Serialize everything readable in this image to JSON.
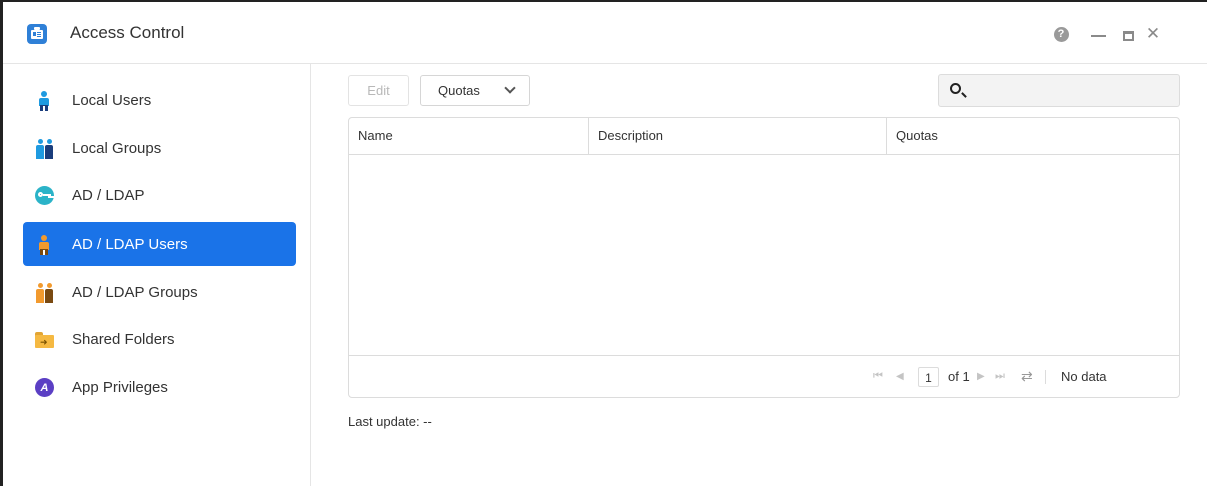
{
  "window": {
    "title": "Access Control",
    "controls": [
      "help-icon",
      "minimize-icon",
      "maximize-icon",
      "close-icon"
    ],
    "help_glyph": "?",
    "close_glyph": "✕"
  },
  "sidebar": {
    "active_color": "#1a73e8",
    "items": [
      {
        "label": "Local Users",
        "icon": "local-user-icon"
      },
      {
        "label": "Local Groups",
        "icon": "local-group-icon"
      },
      {
        "label": "AD / LDAP",
        "icon": "ldap-key-icon"
      },
      {
        "label": "AD / LDAP Users",
        "icon": "ldap-user-icon",
        "active": true
      },
      {
        "label": "AD / LDAP Groups",
        "icon": "ldap-group-icon"
      },
      {
        "label": "Shared Folders",
        "icon": "shared-folder-icon"
      },
      {
        "label": "App Privileges",
        "icon": "app-privileges-icon",
        "glyph": "A"
      }
    ]
  },
  "toolbar": {
    "edit_label": "Edit",
    "quotas_label": "Quotas",
    "search_value": "",
    "search_placeholder": ""
  },
  "table": {
    "columns": [
      "Name",
      "Description",
      "Quotas"
    ],
    "rows": []
  },
  "pagination": {
    "current_page": "1",
    "of_text": "of 1",
    "status": "No data"
  },
  "footer": {
    "last_update": "Last update: --"
  }
}
